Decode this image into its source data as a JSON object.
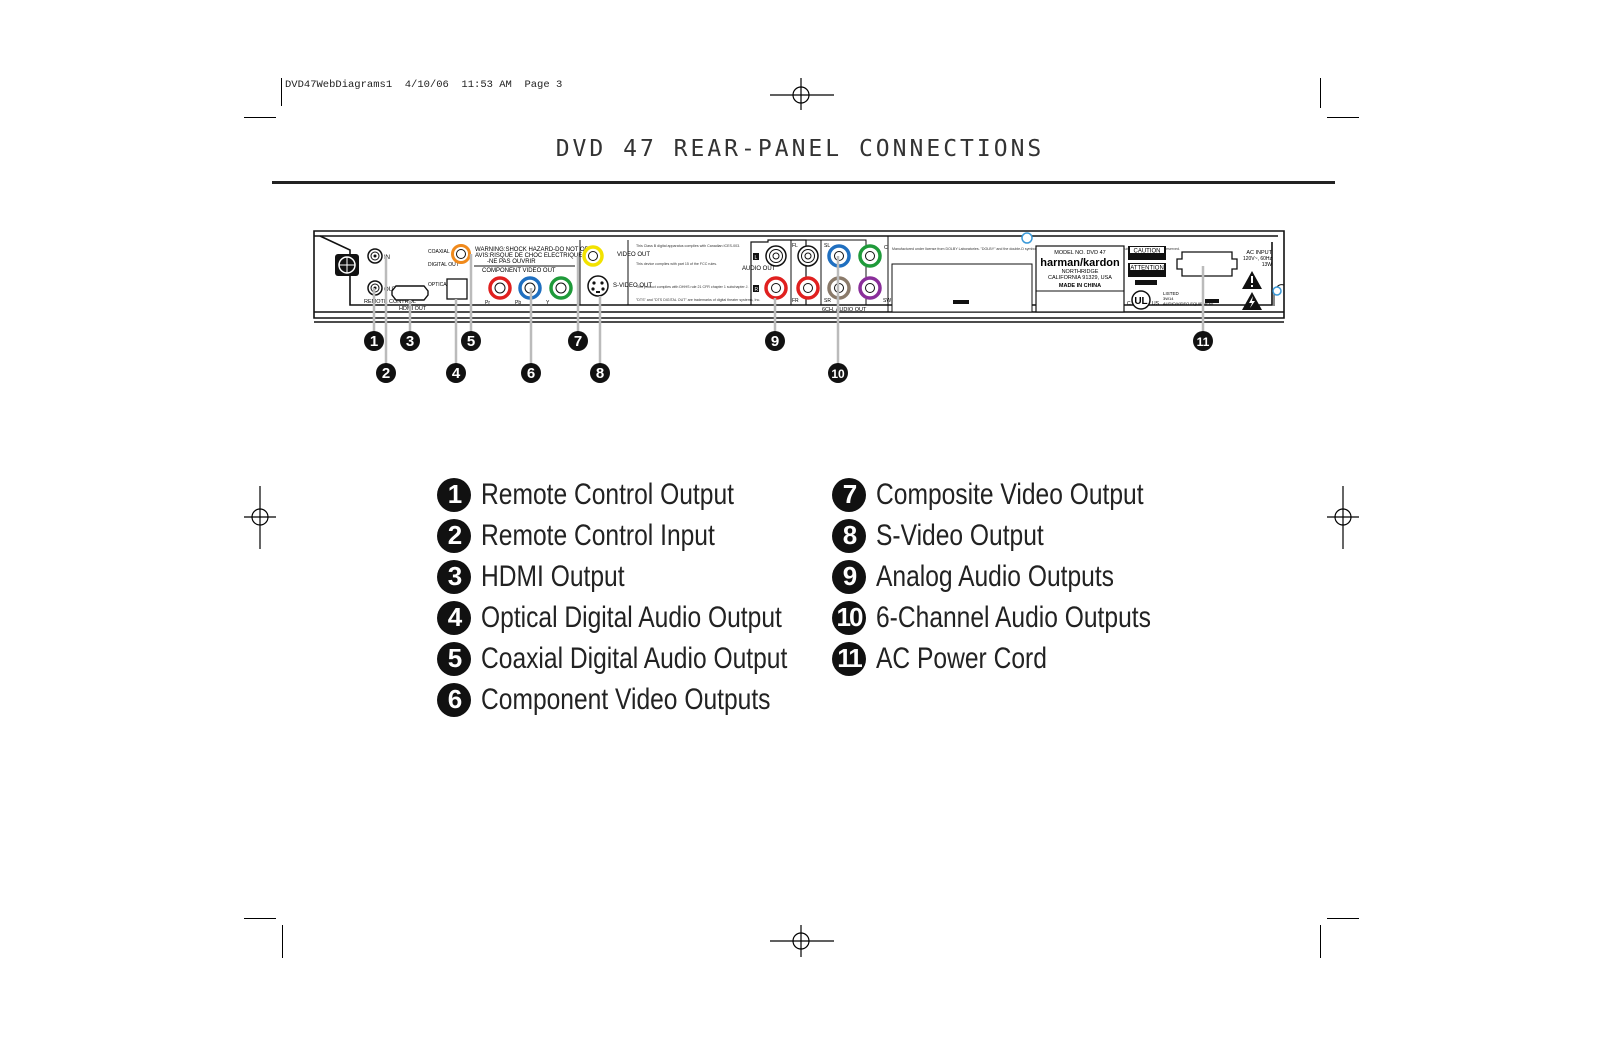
{
  "slug": {
    "text": "DVD47WebDiagrams1  4/10/06  11:53 AM  Page 3"
  },
  "title": "DVD 47 REAR-PANEL CONNECTIONS",
  "panel": {
    "labels": {
      "remote_in": "IN",
      "remote_out": "OUT",
      "remote_control": "REMOTE CONTROL",
      "hdmi_out": "HDMI OUT",
      "coaxial": "COAXIAL",
      "digital_out": "DIGITAL OUT",
      "optical": "OPTICAL",
      "warning_1": "WARNING:SHOCK HAZARD-DO NOT OPEN",
      "warning_2": "AVIS:RISQUE DE CHOC ELECTRIQUE",
      "warning_3": "-NE PAS OUVRIR",
      "component_video_out": "COMPONENT VIDEO OUT",
      "pr": "Pr",
      "pb": "Pb",
      "y": "Y",
      "video_out": "VIDEO OUT",
      "s_video_out": "S-VIDEO OUT",
      "audio_out": "AUDIO OUT",
      "left": "L",
      "right": "R",
      "fl": "FL",
      "fr": "FR",
      "sl": "SL",
      "sr": "SR",
      "c": "C",
      "sw": "SW",
      "six_ch_audio_out": "6CH. AUDIO OUT",
      "dolby_notice": "Manufactured under license from DOLBY Laboratories. \"DOLBY\" and the double-D symbol are trademarks of Dolby Laboratories. Confidential unpublished works. All rights reserved.",
      "fcc_notice_1": "This Class B digital apparatus complies with Canadian ICES-003.",
      "fcc_notice_2": "This device complies with part 15 of the FCC rules.",
      "fcc_notice_3": "This product complies with DHHS rule 21 CFR chapter 1 subchapter J.",
      "dts_notice": "\"DTS\" and \"DTS DIGITAL OUT\" are trademarks of digital theater systems, Inc.",
      "model_no": "MODEL NO. DVD 47",
      "brand": "harman/kardon",
      "city": "NORTHRIDGE",
      "state": "CALIFORNIA 91329, USA",
      "made_in": "MADE IN CHINA",
      "caution": "CAUTION",
      "attention": "ATTENTION",
      "listed": "LISTED",
      "ul_code": "3W14",
      "ul_category": "AUDIO/VIDEO EQUIPMENT",
      "ul_c": "C",
      "ul_us": "US",
      "ac_input": "AC INPUT",
      "ac_rating": "120V~, 60Hz",
      "ac_watts": "13W"
    },
    "callouts": [
      "1",
      "2",
      "3",
      "4",
      "5",
      "6",
      "7",
      "8",
      "9",
      "10",
      "11"
    ],
    "jack_colors": {
      "coaxial": "#f08a1c",
      "pr": "#e0201f",
      "pb": "#1f6fc0",
      "y": "#1f9a3a",
      "composite": "#f2e200",
      "audio_l": "#ffffff",
      "audio_r": "#e0201f",
      "fl": "#ffffff",
      "fr": "#e0201f",
      "sl": "#1f6fc0",
      "sr": "#8a7a6a",
      "c": "#1f9a3a",
      "sw": "#8a2e9a",
      "accent_ring": "#3b9ad9"
    }
  },
  "legend": {
    "left": [
      {
        "num": "1",
        "label": "Remote Control Output"
      },
      {
        "num": "2",
        "label": "Remote Control Input"
      },
      {
        "num": "3",
        "label": "HDMI Output"
      },
      {
        "num": "4",
        "label": "Optical Digital Audio Output"
      },
      {
        "num": "5",
        "label": "Coaxial Digital Audio Output"
      },
      {
        "num": "6",
        "label": "Component Video Outputs"
      }
    ],
    "right": [
      {
        "num": "7",
        "label": "Composite Video Output"
      },
      {
        "num": "8",
        "label": "S-Video Output"
      },
      {
        "num": "9",
        "label": "Analog Audio Outputs"
      },
      {
        "num": "10",
        "label": "6-Channel Audio Outputs"
      },
      {
        "num": "11",
        "label": "AC Power Cord"
      }
    ]
  }
}
